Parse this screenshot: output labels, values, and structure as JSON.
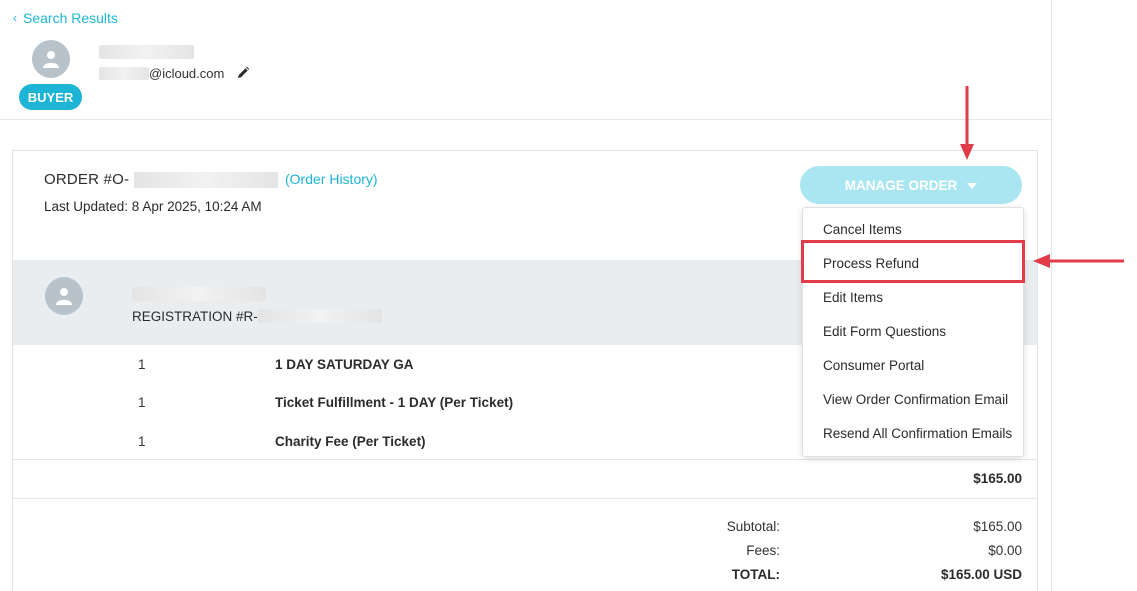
{
  "nav": {
    "back_label": "Search Results"
  },
  "buyer": {
    "email_domain": "@icloud.com",
    "badge": "BUYER"
  },
  "order": {
    "title_prefix": "ORDER #O-",
    "history_link": "(Order History)",
    "last_updated": "Last Updated: 8 Apr 2025, 10:24 AM",
    "manage_button": "MANAGE ORDER"
  },
  "registration": {
    "label_prefix": "REGISTRATION #R-"
  },
  "items": [
    {
      "qty": "1",
      "name": "1 DAY SATURDAY GA"
    },
    {
      "qty": "1",
      "name": "Ticket Fulfillment - 1 DAY (Per Ticket)"
    },
    {
      "qty": "1",
      "name": "Charity Fee (Per Ticket)"
    }
  ],
  "items_total": "$165.00",
  "totals": {
    "subtotal_label": "Subtotal:",
    "subtotal_value": "$165.00",
    "fees_label": "Fees:",
    "fees_value": "$0.00",
    "total_label": "TOTAL:",
    "total_value": "$165.00 USD"
  },
  "manage_menu": [
    "Cancel Items",
    "Process Refund",
    "Edit Items",
    "Edit Form Questions",
    "Consumer Portal",
    "View Order Confirmation Email",
    "Resend All Confirmation Emails"
  ],
  "colors": {
    "accent": "#1db4d6",
    "manage_button_bg": "#a9e6f2",
    "annotation_red": "#e23b4a",
    "registration_band": "#eaedf0"
  },
  "icons": {
    "back": "chevron-left-icon",
    "edit": "pencil-icon",
    "avatar": "user-avatar-icon",
    "manage_caret": "caret-down-icon"
  }
}
